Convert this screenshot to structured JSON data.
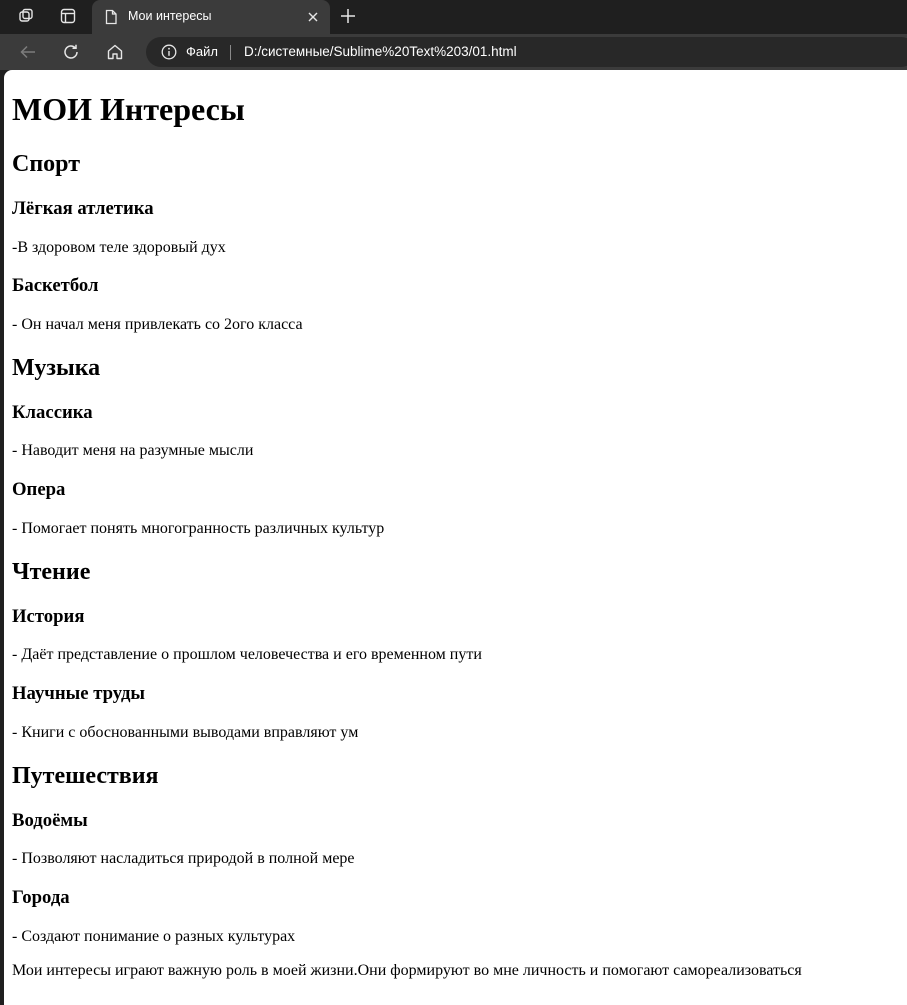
{
  "browser": {
    "tab": {
      "title": "Мои интересы"
    },
    "address_bar": {
      "scheme_label": "Файл",
      "url": "D:/системные/Sublime%20Text%203/01.html"
    },
    "icons": [
      "workspaces-icon",
      "tab-actions-icon",
      "page-icon",
      "close-icon",
      "new-tab-icon",
      "back-icon",
      "refresh-icon",
      "home-icon",
      "info-icon"
    ]
  },
  "page": {
    "title": "МОИ Интересы",
    "sections": [
      {
        "heading": "Спорт",
        "items": [
          {
            "heading": "Лёгкая атлетика",
            "text": "-В здоровом теле здоровый дух"
          },
          {
            "heading": "Баскетбол",
            "text": "- Он начал меня привлекать со 2ого класса"
          }
        ]
      },
      {
        "heading": "Музыка",
        "items": [
          {
            "heading": "Классика",
            "text": "- Наводит меня на разумные мысли"
          },
          {
            "heading": "Опера",
            "text": "- Помогает понять многогранность различных культур"
          }
        ]
      },
      {
        "heading": "Чтение",
        "items": [
          {
            "heading": "История",
            "text": "- Даёт представление о прошлом человечества и его временном пути"
          },
          {
            "heading": "Научные труды",
            "text": "- Книги с обоснованными выводами вправляют ум"
          }
        ]
      },
      {
        "heading": "Путешествия",
        "items": [
          {
            "heading": "Водоёмы",
            "text": "- Позволяют насладиться природой в полной мере"
          },
          {
            "heading": "Города",
            "text": "- Создают понимание о разных культурах"
          }
        ]
      }
    ],
    "closing": "Мои интересы играют важную роль в моей жизни.Они формируют во мне личность и помогают самореализоваться"
  }
}
